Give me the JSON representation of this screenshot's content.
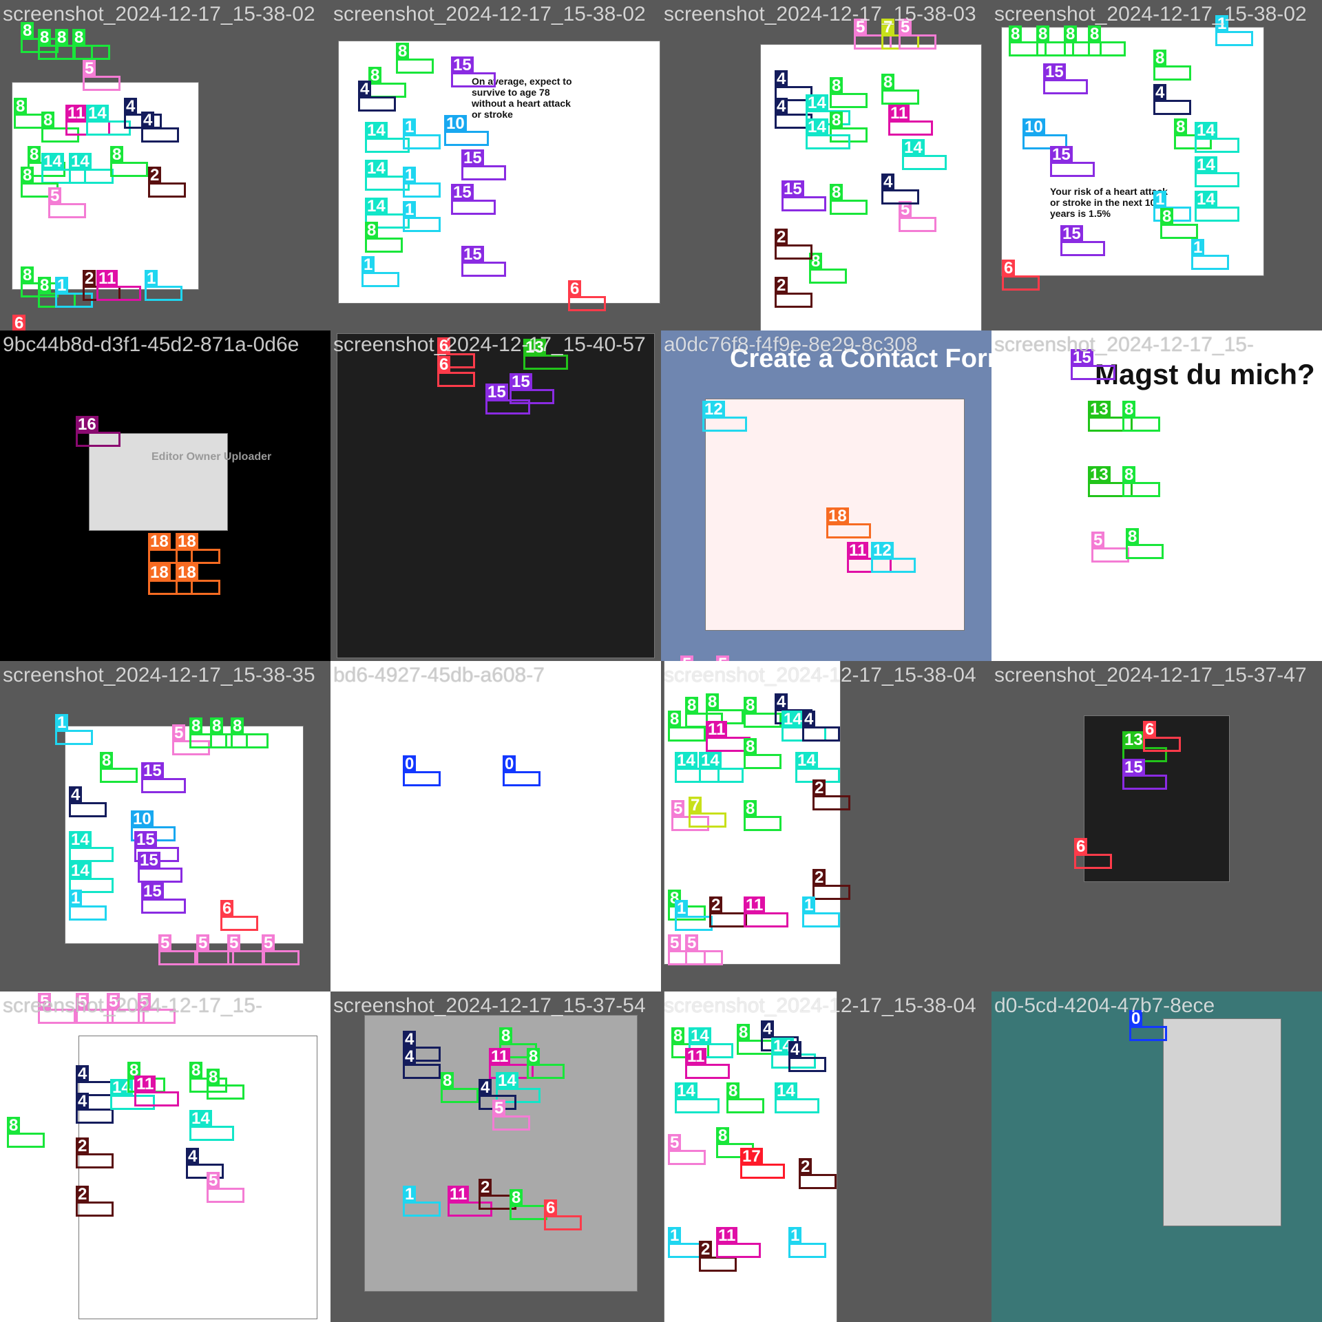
{
  "palette": {
    "0": "#1338ff",
    "1": "#1fd6f0",
    "2": "#5a1010",
    "4": "#141c5c",
    "5": "#f47cd4",
    "6": "#ff3b4a",
    "7": "#c8e01a",
    "8": "#19e63a",
    "10": "#18a8f0",
    "11": "#e00fa6",
    "12": "#22d8ee",
    "13": "#22c41a",
    "14": "#12e6c8",
    "15": "#8a2be2",
    "16": "#8a0a70",
    "17": "#ff1a2a",
    "18": "#f76b22"
  },
  "tiles": [
    {
      "id": "t0",
      "title": "screenshot_2024-12-17_15-38-02",
      "bg": "#595959",
      "text": "",
      "dots": [
        [
          "#2",
          "8",
          30,
          30
        ],
        [
          "8",
          "8",
          55,
          40
        ],
        [
          "8",
          "8",
          80,
          40
        ],
        [
          "8",
          "8",
          105,
          40
        ],
        [
          "5",
          "5",
          120,
          85
        ],
        [
          "8",
          "8",
          20,
          140
        ],
        [
          "8",
          "8",
          60,
          160
        ],
        [
          "11",
          "11",
          95,
          150
        ],
        [
          "14",
          "14",
          125,
          150
        ],
        [
          "4",
          "4",
          180,
          140
        ],
        [
          "4",
          "4",
          205,
          160
        ],
        [
          "8",
          "8",
          40,
          210
        ],
        [
          "14",
          "14",
          60,
          220
        ],
        [
          "14",
          "14",
          100,
          220
        ],
        [
          "8",
          "8",
          160,
          210
        ],
        [
          "8",
          "8",
          30,
          240
        ],
        [
          "5",
          "5",
          70,
          270
        ],
        [
          "2",
          "2",
          215,
          240
        ],
        [
          "8",
          "8",
          30,
          385
        ],
        [
          "8",
          "8",
          55,
          400
        ],
        [
          "1",
          "1",
          80,
          400
        ],
        [
          "2",
          "2",
          120,
          390
        ],
        [
          "11",
          "11",
          140,
          390
        ],
        [
          "1",
          "1",
          210,
          390
        ],
        [
          "6",
          "6",
          18,
          455
        ]
      ]
    },
    {
      "id": "t1",
      "title": "screenshot_2024-12-17_15-38-02",
      "bg": "#595959",
      "text": "On average, expect to survive to age 78 without a heart attack or stroke",
      "dots": [
        [
          "8",
          "8",
          95,
          60
        ],
        [
          "8",
          "8",
          55,
          95
        ],
        [
          "4",
          "4",
          40,
          115
        ],
        [
          "15",
          "15",
          175,
          80
        ],
        [
          "10",
          "10",
          165,
          165
        ],
        [
          "15",
          "15",
          190,
          215
        ],
        [
          "15",
          "15",
          175,
          265
        ],
        [
          "14",
          "14",
          50,
          175
        ],
        [
          "14",
          "14",
          50,
          230
        ],
        [
          "14",
          "14",
          50,
          285
        ],
        [
          "1",
          "1",
          105,
          170
        ],
        [
          "1",
          "1",
          105,
          240
        ],
        [
          "1",
          "1",
          105,
          290
        ],
        [
          "8",
          "8",
          50,
          320
        ],
        [
          "1",
          "1",
          45,
          370
        ],
        [
          "15",
          "15",
          190,
          355
        ],
        [
          "6",
          "6",
          345,
          405
        ]
      ]
    },
    {
      "id": "t2",
      "title": "screenshot_2024-12-17_15-38-03",
      "bg": "#595959",
      "text": "",
      "dots": [
        [
          "5",
          "5",
          280,
          25
        ],
        [
          "7",
          "7",
          320,
          25
        ],
        [
          "5",
          "5",
          345,
          25
        ],
        [
          "4",
          "4",
          165,
          100
        ],
        [
          "4",
          "4",
          165,
          140
        ],
        [
          "14",
          "14",
          210,
          135
        ],
        [
          "8",
          "8",
          245,
          110
        ],
        [
          "8",
          "8",
          245,
          160
        ],
        [
          "14",
          "14",
          210,
          170
        ],
        [
          "8",
          "8",
          320,
          105
        ],
        [
          "11",
          "11",
          330,
          150
        ],
        [
          "14",
          "14",
          350,
          200
        ],
        [
          "15",
          "15",
          175,
          260
        ],
        [
          "8",
          "8",
          245,
          265
        ],
        [
          "8",
          "8",
          215,
          365
        ],
        [
          "2",
          "2",
          165,
          330
        ],
        [
          "2",
          "2",
          165,
          400
        ],
        [
          "5",
          "5",
          345,
          290
        ],
        [
          "4",
          "4",
          320,
          250
        ]
      ]
    },
    {
      "id": "t3",
      "title": "screenshot_2024-12-17_15-38-02",
      "bg": "#595959",
      "text": "Your risk of a heart attack or stroke in the next 10 years is 1.5%",
      "dots": [
        [
          "8",
          "8",
          25,
          35
        ],
        [
          "8",
          "8",
          65,
          35
        ],
        [
          "8",
          "8",
          105,
          35
        ],
        [
          "8",
          "8",
          140,
          35
        ],
        [
          "1",
          "1",
          325,
          20
        ],
        [
          "15",
          "15",
          75,
          90
        ],
        [
          "10",
          "10",
          45,
          170
        ],
        [
          "15",
          "15",
          85,
          210
        ],
        [
          "15",
          "15",
          100,
          325
        ],
        [
          "8",
          "8",
          235,
          70
        ],
        [
          "4",
          "4",
          235,
          120
        ],
        [
          "8",
          "8",
          265,
          170
        ],
        [
          "14",
          "14",
          295,
          175
        ],
        [
          "14",
          "14",
          295,
          225
        ],
        [
          "14",
          "14",
          295,
          275
        ],
        [
          "1",
          "1",
          235,
          275
        ],
        [
          "8",
          "8",
          245,
          300
        ],
        [
          "1",
          "1",
          290,
          345
        ],
        [
          "6",
          "6",
          15,
          375
        ]
      ]
    },
    {
      "id": "t4",
      "title": "9bc44b8d-d3f1-45d2-871a-0d6e",
      "bg": "#000000",
      "text": "Editor Owner Uploader",
      "dots": [
        [
          "16",
          "16",
          110,
          122
        ],
        [
          "18",
          "18",
          215,
          292
        ],
        [
          "18",
          "18",
          255,
          292
        ],
        [
          "18",
          "18",
          215,
          337
        ],
        [
          "18",
          "18",
          255,
          337
        ]
      ]
    },
    {
      "id": "t5",
      "title": "screenshot_2024-12-17_15-40-57",
      "bg": "#595959",
      "text": "",
      "dots": [
        [
          "6",
          "6",
          155,
          8
        ],
        [
          "6",
          "6",
          155,
          35
        ],
        [
          "13",
          "13",
          280,
          10
        ],
        [
          "15",
          "15",
          225,
          75
        ],
        [
          "15",
          "15",
          260,
          60
        ]
      ]
    },
    {
      "id": "t6",
      "title": "a0dc76f8-f4f9e-8e29-8c308",
      "bg": "#6f86b0",
      "text": "Create a Contact Form",
      "dots": [
        [
          "12",
          "12",
          60,
          100
        ],
        [
          "18",
          "18",
          240,
          255
        ],
        [
          "11",
          "11",
          270,
          305
        ],
        [
          "12",
          "12",
          305,
          305
        ],
        [
          "5",
          "5",
          28,
          470
        ],
        [
          "5",
          "5",
          80,
          470
        ]
      ]
    },
    {
      "id": "t7",
      "title": "screenshot_2024-12-17_15-",
      "bg": "#ffffff",
      "text": "Magst du mich?",
      "dots": [
        [
          "15",
          "15",
          115,
          25
        ],
        [
          "13",
          "13",
          140,
          100
        ],
        [
          "8",
          "8",
          190,
          100
        ],
        [
          "13",
          "13",
          140,
          195
        ],
        [
          "8",
          "8",
          190,
          195
        ],
        [
          "5",
          "5",
          145,
          290
        ],
        [
          "8",
          "8",
          195,
          285
        ]
      ]
    },
    {
      "id": "t8",
      "title": "screenshot_2024-12-17_15-38-35",
      "bg": "#595959",
      "text": "",
      "dots": [
        [
          "1",
          "1",
          80,
          75
        ],
        [
          "5",
          "5",
          250,
          90
        ],
        [
          "8",
          "8",
          275,
          80
        ],
        [
          "8",
          "8",
          305,
          80
        ],
        [
          "8",
          "8",
          335,
          80
        ],
        [
          "8",
          "8",
          145,
          130
        ],
        [
          "15",
          "15",
          205,
          145
        ],
        [
          "4",
          "4",
          100,
          180
        ],
        [
          "10",
          "10",
          190,
          215
        ],
        [
          "15",
          "15",
          195,
          245
        ],
        [
          "15",
          "15",
          200,
          275
        ],
        [
          "15",
          "15",
          205,
          320
        ],
        [
          "14",
          "14",
          100,
          245
        ],
        [
          "14",
          "14",
          100,
          290
        ],
        [
          "1",
          "1",
          100,
          330
        ],
        [
          "6",
          "6",
          320,
          345
        ],
        [
          "5",
          "5",
          230,
          395
        ],
        [
          "5",
          "5",
          285,
          395
        ],
        [
          "5",
          "5",
          330,
          395
        ],
        [
          "5",
          "5",
          380,
          395
        ]
      ]
    },
    {
      "id": "t9",
      "title": "bd6-4927-45db-a608-7",
      "bg": "#ffffff",
      "text": "",
      "dots": [
        [
          "0",
          "0",
          105,
          135
        ],
        [
          "0",
          "0",
          250,
          135
        ]
      ]
    },
    {
      "id": "t10",
      "title": "screenshot_2024-12-17_15-38-04",
      "bg": "#595959",
      "text": "",
      "dots": [
        [
          "8",
          "8",
          10,
          70
        ],
        [
          "8",
          "8",
          35,
          50
        ],
        [
          "8",
          "8",
          65,
          45
        ],
        [
          "11",
          "11",
          65,
          85
        ],
        [
          "8",
          "8",
          120,
          50
        ],
        [
          "4",
          "4",
          165,
          45
        ],
        [
          "14",
          "14",
          175,
          70
        ],
        [
          "4",
          "4",
          205,
          70
        ],
        [
          "14",
          "14",
          20,
          130
        ],
        [
          "14",
          "14",
          55,
          130
        ],
        [
          "8",
          "8",
          120,
          110
        ],
        [
          "14",
          "14",
          195,
          130
        ],
        [
          "5",
          "5",
          15,
          200
        ],
        [
          "7",
          "7",
          40,
          195
        ],
        [
          "8",
          "8",
          120,
          200
        ],
        [
          "2",
          "2",
          220,
          170
        ],
        [
          "2",
          "2",
          220,
          300
        ],
        [
          "8",
          "8",
          10,
          330
        ],
        [
          "1",
          "1",
          20,
          345
        ],
        [
          "2",
          "2",
          70,
          340
        ],
        [
          "11",
          "11",
          120,
          340
        ],
        [
          "1",
          "1",
          205,
          340
        ],
        [
          "5",
          "5",
          10,
          395
        ],
        [
          "5",
          "5",
          35,
          395
        ]
      ]
    },
    {
      "id": "t11",
      "title": "screenshot_2024-12-17_15-37-47",
      "bg": "#595959",
      "text": "",
      "dots": [
        [
          "13",
          "13",
          190,
          100
        ],
        [
          "6",
          "6",
          220,
          85
        ],
        [
          "15",
          "15",
          190,
          140
        ],
        [
          "6",
          "6",
          120,
          255
        ]
      ]
    },
    {
      "id": "t12",
      "title": "screenshot_2024-12-17_15-",
      "bg": "#ffffff",
      "text": "",
      "dots": [
        [
          "5",
          "5",
          55,
          0
        ],
        [
          "5",
          "5",
          110,
          0
        ],
        [
          "5",
          "5",
          155,
          0
        ],
        [
          "5",
          "5",
          200,
          0
        ],
        [
          "4",
          "4",
          110,
          105
        ],
        [
          "4",
          "4",
          110,
          145
        ],
        [
          "14",
          "14",
          160,
          125
        ],
        [
          "8",
          "8",
          185,
          100
        ],
        [
          "11",
          "11",
          195,
          120
        ],
        [
          "8",
          "8",
          275,
          100
        ],
        [
          "8",
          "8",
          300,
          110
        ],
        [
          "14",
          "14",
          275,
          170
        ],
        [
          "2",
          "2",
          110,
          210
        ],
        [
          "2",
          "2",
          110,
          280
        ],
        [
          "4",
          "4",
          270,
          225
        ],
        [
          "5",
          "5",
          300,
          260
        ],
        [
          "8",
          "8",
          10,
          180
        ]
      ]
    },
    {
      "id": "t13",
      "title": "screenshot_2024-12-17_15-37-54",
      "bg": "#595959",
      "text": "",
      "dots": [
        [
          "4",
          "4",
          105,
          55
        ],
        [
          "4",
          "4",
          105,
          80
        ],
        [
          "8",
          "8",
          245,
          50
        ],
        [
          "11",
          "11",
          230,
          80
        ],
        [
          "14",
          "14",
          240,
          115
        ],
        [
          "8",
          "8",
          160,
          115
        ],
        [
          "8",
          "8",
          285,
          80
        ],
        [
          "4",
          "4",
          215,
          125
        ],
        [
          "5",
          "5",
          235,
          155
        ],
        [
          "1",
          "1",
          105,
          280
        ],
        [
          "11",
          "11",
          170,
          280
        ],
        [
          "2",
          "2",
          215,
          270
        ],
        [
          "8",
          "8",
          260,
          285
        ],
        [
          "6",
          "6",
          310,
          300
        ]
      ]
    },
    {
      "id": "t14",
      "title": "screenshot_2024-12-17_15-38-04",
      "bg": "#595959",
      "text": "",
      "dots": [
        [
          "8",
          "8",
          15,
          50
        ],
        [
          "14",
          "14",
          40,
          50
        ],
        [
          "8",
          "8",
          110,
          45
        ],
        [
          "4",
          "4",
          145,
          40
        ],
        [
          "14",
          "14",
          160,
          65
        ],
        [
          "4",
          "4",
          185,
          70
        ],
        [
          "11",
          "11",
          35,
          80
        ],
        [
          "14",
          "14",
          20,
          130
        ],
        [
          "8",
          "8",
          95,
          130
        ],
        [
          "14",
          "14",
          165,
          130
        ],
        [
          "5",
          "5",
          10,
          205
        ],
        [
          "8",
          "8",
          80,
          195
        ],
        [
          "17",
          "17",
          115,
          225
        ],
        [
          "2",
          "2",
          200,
          240
        ],
        [
          "1",
          "1",
          10,
          340
        ],
        [
          "2",
          "2",
          55,
          360
        ],
        [
          "11",
          "11",
          80,
          340
        ],
        [
          "1",
          "1",
          185,
          340
        ]
      ]
    },
    {
      "id": "t15",
      "title": "d0-5cd-4204-47b7-8ece",
      "bg": "#3a7776",
      "text": "",
      "dots": [
        [
          "0",
          "0",
          200,
          25
        ]
      ]
    }
  ]
}
